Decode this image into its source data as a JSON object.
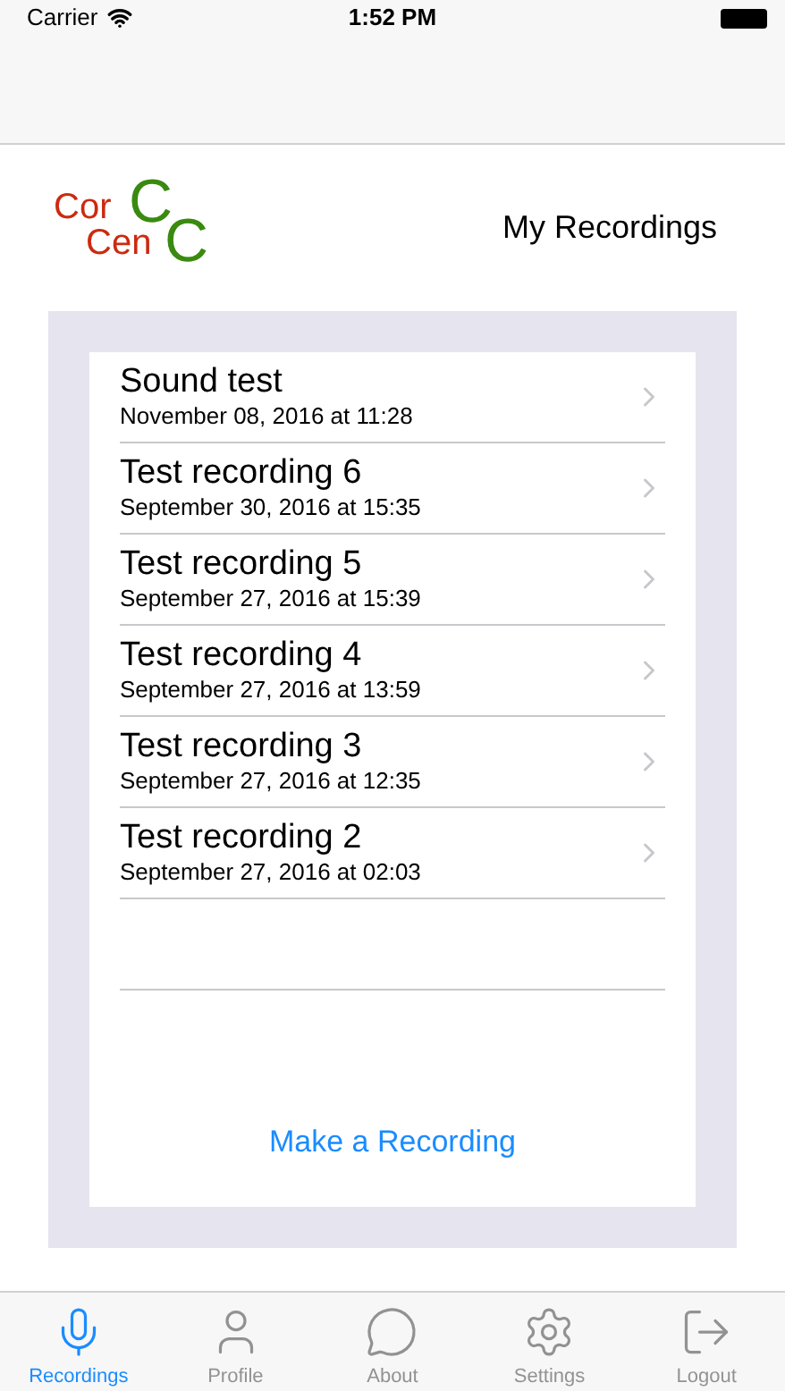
{
  "status_bar": {
    "carrier": "Carrier",
    "time": "1:52 PM"
  },
  "logo": {
    "parts": [
      {
        "text": "Cor",
        "color": "#cc2a10"
      },
      {
        "text": "Cen",
        "color": "#cc2a10"
      },
      {
        "text": "C",
        "color": "#3a8a10"
      },
      {
        "text": "C",
        "color": "#3a8a10"
      }
    ]
  },
  "title": "My Recordings",
  "recordings": [
    {
      "name": "Sound test",
      "date": "November 08, 2016 at 11:28"
    },
    {
      "name": "Test recording 6",
      "date": "September 30, 2016 at 15:35"
    },
    {
      "name": "Test recording 5",
      "date": "September 27, 2016 at 15:39"
    },
    {
      "name": "Test recording 4",
      "date": "September 27, 2016 at 13:59"
    },
    {
      "name": "Test recording 3",
      "date": "September 27, 2016 at 12:35"
    },
    {
      "name": "Test recording 2",
      "date": "September 27, 2016 at 02:03"
    }
  ],
  "action": "Make a Recording",
  "tabs": [
    {
      "kind": "mic",
      "label": "Recordings",
      "selected": true
    },
    {
      "kind": "person",
      "label": "Profile",
      "selected": false
    },
    {
      "kind": "info",
      "label": "About",
      "selected": false
    },
    {
      "kind": "gear",
      "label": "Settings",
      "selected": false
    },
    {
      "kind": "logout",
      "label": "Logout",
      "selected": false
    }
  ]
}
